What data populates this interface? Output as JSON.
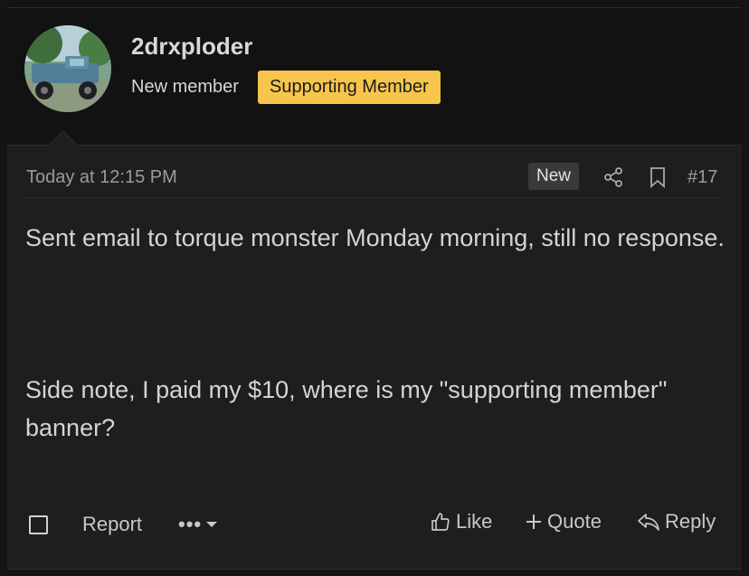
{
  "user": {
    "name": "2drxploder",
    "title": "New member",
    "badge": "Supporting Member"
  },
  "post": {
    "timestamp": "Today at 12:15 PM",
    "new_label": "New",
    "number": "#17",
    "paragraphs": [
      "Sent email to torque monster Monday morning, still no response.",
      "Side note, I paid my $10, where is my \"supporting member\" banner?"
    ]
  },
  "footer": {
    "report": "Report",
    "more": "•••",
    "like": "Like",
    "quote": "Quote",
    "reply": "Reply"
  },
  "colors": {
    "badge_bg": "#f6c54b",
    "post_bg": "#1e1e1f",
    "header_bg": "#121212"
  },
  "icons": [
    "share-icon",
    "bookmark-icon",
    "thumbs-up-icon",
    "plus-icon",
    "reply-icon",
    "chevron-down-icon"
  ]
}
